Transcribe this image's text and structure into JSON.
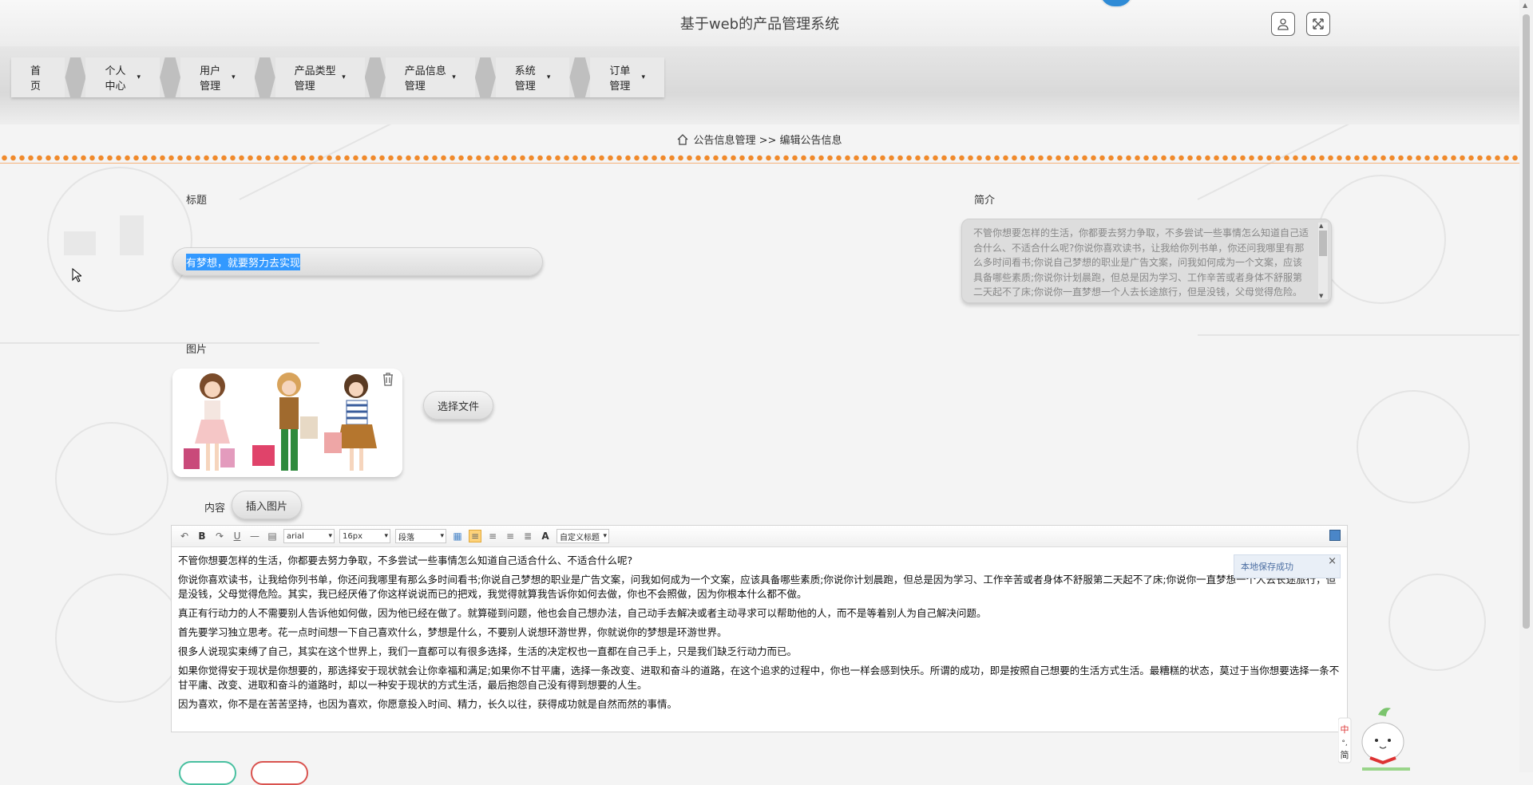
{
  "app": {
    "title": "基于web的产品管理系统"
  },
  "nav": {
    "items": [
      {
        "label": "首页",
        "caret": ""
      },
      {
        "label": "个人中心",
        "caret": "▾"
      },
      {
        "label": "用户管理",
        "caret": "▾"
      },
      {
        "label": "产品类型管理",
        "caret": "▾"
      },
      {
        "label": "产品信息管理",
        "caret": "▾"
      },
      {
        "label": "系统管理",
        "caret": "▾"
      },
      {
        "label": "订单管理",
        "caret": "▾"
      }
    ]
  },
  "breadcrumb": {
    "section": "公告信息管理",
    "separator": ">>",
    "page": "编辑公告信息"
  },
  "form": {
    "title_label": "标题",
    "title_value": "有梦想，就要努力去实现",
    "intro_label": "简介",
    "intro_value": "不管你想要怎样的生活，你都要去努力争取，不多尝试一些事情怎么知道自己适合什么、不适合什么呢?你说你喜欢读书，让我给你列书单，你还问我哪里有那么多时间看书;你说自己梦想的职业是广告文案，问我如何成为一个文案，应该具备哪些素质;你说你计划晨跑，但总是因为学习、工作辛苦或者身体不舒服第二天起不了床;你说你一直梦想一个人去长途旅行，但是没钱，父母觉得危险。",
    "image_label": "图片",
    "choose_file": "选择文件",
    "content_label": "内容",
    "insert_image": "插入图片"
  },
  "editor": {
    "font": "arial",
    "size": "16px",
    "paragraph": "段落",
    "heading": "自定义标题",
    "toast": "本地保存成功",
    "paragraphs": [
      "不管你想要怎样的生活，你都要去努力争取，不多尝试一些事情怎么知道自己适合什么、不适合什么呢?",
      "你说你喜欢读书，让我给你列书单，你还问我哪里有那么多时间看书;你说自己梦想的职业是广告文案，问我如何成为一个文案，应该具备哪些素质;你说你计划晨跑，但总是因为学习、工作辛苦或者身体不舒服第二天起不了床;你说你一直梦想一个人去长途旅行，但是没钱，父母觉得危险。其实，我已经厌倦了你这样说说而已的把戏，我觉得就算我告诉你如何去做，你也不会照做，因为你根本什么都不做。",
      "真正有行动力的人不需要别人告诉他如何做，因为他已经在做了。就算碰到问题，他也会自己想办法，自己动手去解决或者主动寻求可以帮助他的人，而不是等着别人为自己解决问题。",
      "首先要学习独立思考。花一点时间想一下自己喜欢什么，梦想是什么，不要别人说想环游世界，你就说你的梦想是环游世界。",
      "很多人说现实束缚了自己，其实在这个世界上，我们一直都可以有很多选择，生活的决定权也一直都在自己手上，只是我们缺乏行动力而已。",
      "如果你觉得安于现状是你想要的，那选择安于现状就会让你幸福和满足;如果你不甘平庸，选择一条改变、进取和奋斗的道路，在这个追求的过程中，你也一样会感到快乐。所谓的成功，即是按照自己想要的生活方式生活。最糟糕的状态，莫过于当你想要选择一条不甘平庸、改变、进取和奋斗的道路时，却以一种安于现状的方式生活，最后抱怨自己没有得到想要的人生。",
      "因为喜欢，你不是在苦苦坚持，也因为喜欢，你愿意投入时间、精力，长久以往，获得成功就是自然而然的事情。"
    ]
  },
  "mascot": {
    "label": "中\n°,\n简"
  },
  "colors": {
    "accent": "#f08a2c",
    "selection": "#3399ff",
    "ok": "#48c0a0",
    "cancel": "#d9534f"
  }
}
